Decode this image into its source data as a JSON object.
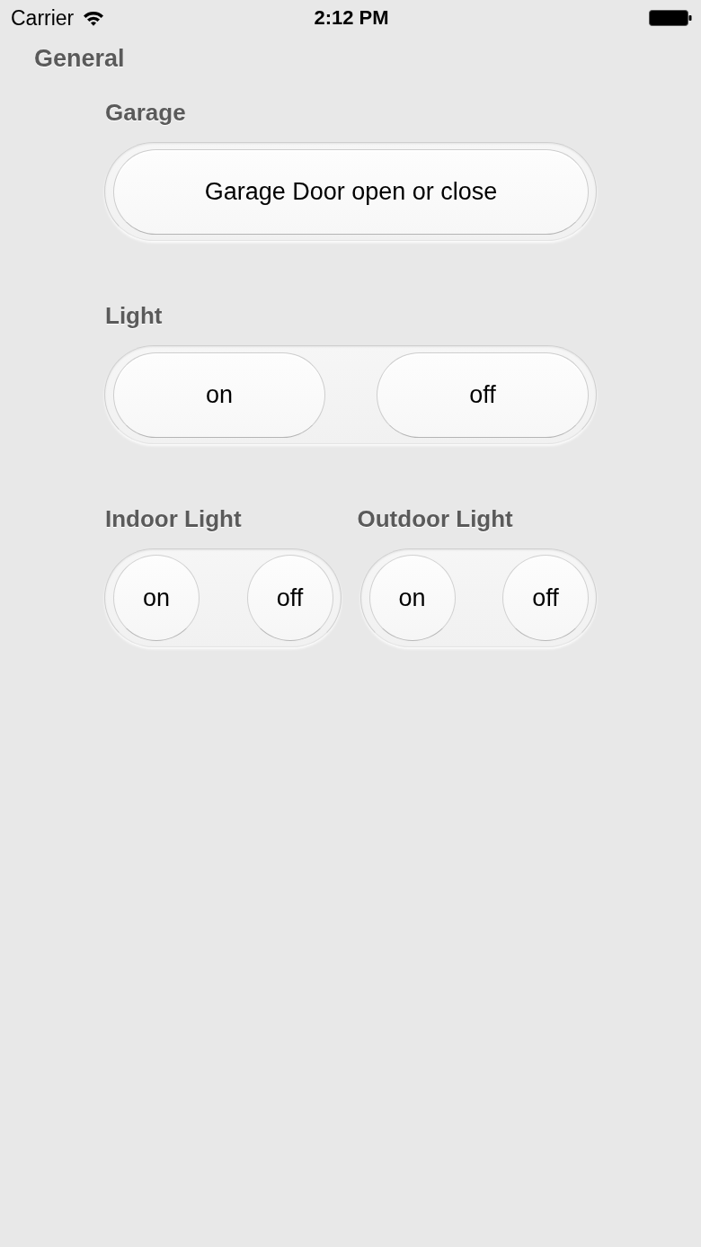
{
  "status_bar": {
    "carrier": "Carrier",
    "time": "2:12 PM"
  },
  "section_title": "General",
  "rows": [
    {
      "groups": [
        {
          "label": "Garage",
          "kind": "pill",
          "buttons": [
            "Garage Door open or close"
          ]
        }
      ]
    },
    {
      "groups": [
        {
          "label": "Light",
          "kind": "pill",
          "buttons": [
            "on",
            "off"
          ]
        }
      ]
    },
    {
      "groups": [
        {
          "label": "Indoor Light",
          "kind": "round",
          "buttons": [
            "on",
            "off"
          ]
        },
        {
          "label": "Outdoor Light",
          "kind": "round",
          "buttons": [
            "on",
            "off"
          ]
        }
      ]
    }
  ]
}
